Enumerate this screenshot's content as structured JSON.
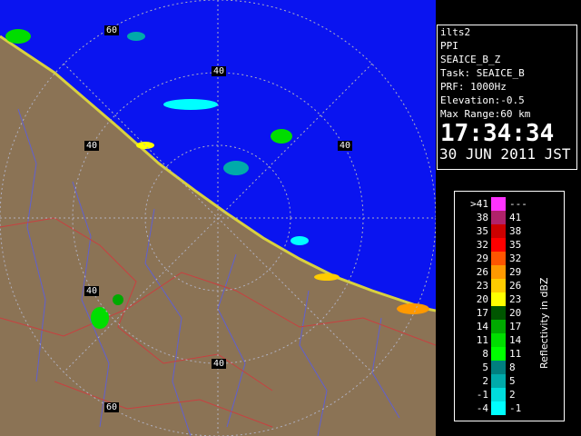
{
  "info": {
    "site": "ilts2",
    "mode": "PPI",
    "product": "SEAICE_B_Z",
    "task": "Task: SEAICE_B",
    "prf": "PRF: 1000Hz",
    "elevation": "Elevation:-0.5",
    "max_range": "Max Range:60 km",
    "time": "17:34:34",
    "date": "30 JUN 2011 JST"
  },
  "range_labels": {
    "r40_top": "40",
    "r60_top": "60",
    "r40_left": "40",
    "r40_right": "40",
    "r40_bottom": "40",
    "r60_bottom": "60",
    "r40_lower_left": "40"
  },
  "colors": {
    "sea": "#0a14f0",
    "land": "#8b7355",
    "river": "#6060d0",
    "border": "#c84040",
    "ring": "#b0b0c0"
  },
  "scale": {
    "unit_label": "Reflectivity in dBZ",
    "rows": [
      {
        "left": ">41",
        "right": "---",
        "color": "#ff33ff"
      },
      {
        "left": "38",
        "right": "41",
        "color": "#b0226a"
      },
      {
        "left": "35",
        "right": "38",
        "color": "#cc0000"
      },
      {
        "left": "32",
        "right": "35",
        "color": "#ff0000"
      },
      {
        "left": "29",
        "right": "32",
        "color": "#ff5500"
      },
      {
        "left": "26",
        "right": "29",
        "color": "#ff9900"
      },
      {
        "left": "23",
        "right": "26",
        "color": "#ffcc00"
      },
      {
        "left": "20",
        "right": "23",
        "color": "#ffff00"
      },
      {
        "left": "17",
        "right": "20",
        "color": "#005500"
      },
      {
        "left": "14",
        "right": "17",
        "color": "#00aa00"
      },
      {
        "left": "11",
        "right": "14",
        "color": "#00dd00"
      },
      {
        "left": "8",
        "right": "11",
        "color": "#00ff00"
      },
      {
        "left": "5",
        "right": "8",
        "color": "#007f7f"
      },
      {
        "left": "2",
        "right": "5",
        "color": "#00aaaa"
      },
      {
        "left": "-1",
        "right": "2",
        "color": "#00dddd"
      },
      {
        "left": "-4",
        "right": "-1",
        "color": "#00ffff"
      }
    ]
  }
}
